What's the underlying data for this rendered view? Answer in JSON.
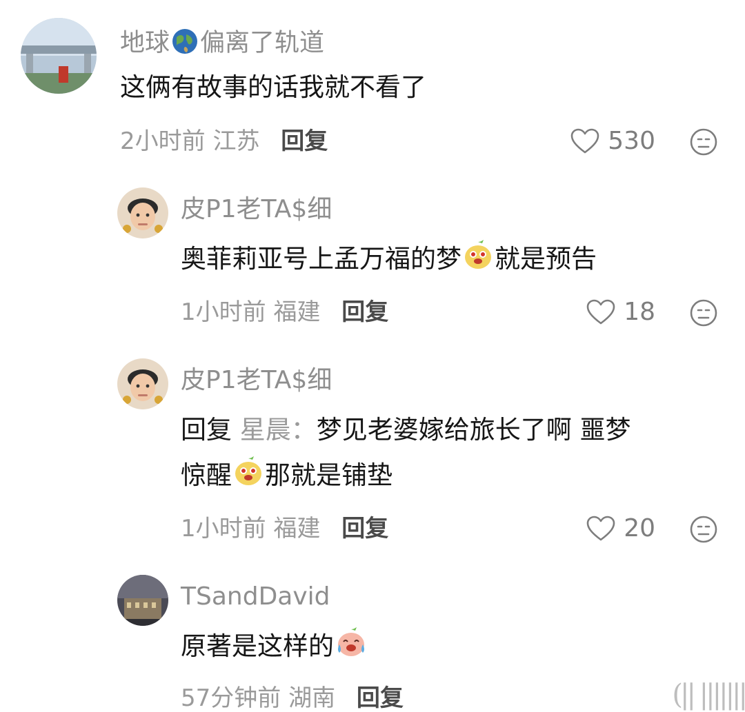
{
  "comments": [
    {
      "username": "地球",
      "username_tail": "偏离了轨道",
      "text": "这俩有故事的话我就不看了",
      "time": "2小时前",
      "location": "江苏",
      "reply_label": "回复",
      "likes": "530"
    },
    {
      "username": "皮P1老TA$细",
      "text_a": "奥菲莉亚号上孟万福的梦",
      "text_b": "就是预告",
      "time": "1小时前",
      "location": "福建",
      "reply_label": "回复",
      "likes": "18"
    },
    {
      "username": "皮P1老TA$细",
      "reply_prefix": "回复",
      "reply_target": "星晨：",
      "text_line1": "梦见老婆嫁给旅长了啊 噩梦",
      "text_line2a": "惊醒",
      "text_line2b": "那就是铺垫",
      "time": "1小时前",
      "location": "福建",
      "reply_label": "回复",
      "likes": "20"
    },
    {
      "username": "TSandDavid",
      "text": "原著是这样的",
      "time": "57分钟前",
      "location": "湖南",
      "reply_label": "回复"
    }
  ],
  "icons": {
    "like": "heart-outline-icon",
    "dislike": "unhappy-face-icon",
    "globe": "globe-emoji",
    "sticker_smile": "peach-smile-sticker",
    "sticker_cry": "peach-cry-sticker"
  },
  "watermark": "(|| |||||||"
}
